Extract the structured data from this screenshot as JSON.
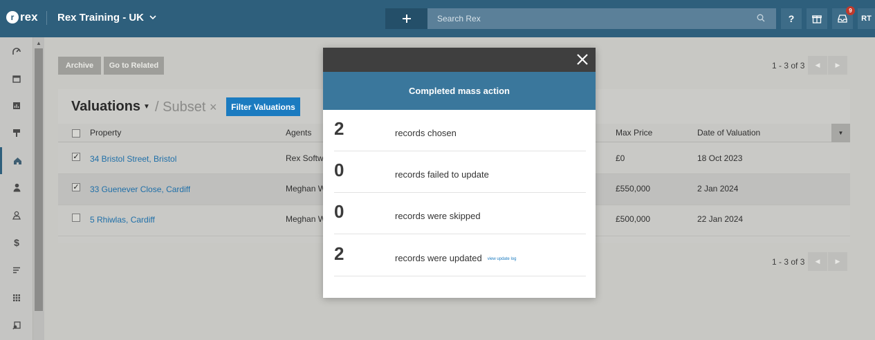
{
  "topbar": {
    "logo_text": "rex",
    "account_name": "Rex Training - UK",
    "search_placeholder": "Search Rex",
    "notifications_count": "9",
    "user_initials": "RT"
  },
  "sidebar": {
    "items": [
      "dashboard-icon",
      "calendar-icon",
      "reports-icon",
      "signboard-icon",
      "properties-icon",
      "contacts-icon",
      "leads-icon",
      "finance-icon",
      "lists-icon",
      "apps-icon",
      "search-listings-icon"
    ]
  },
  "toolbar": {
    "archive_label": "Archive",
    "related_label": "Go to Related",
    "pager_top": "1 - 3 of 3",
    "pager_bottom": "1 - 3 of 3",
    "prev_glyph": "◀",
    "next_glyph": "▶"
  },
  "list": {
    "title": "Valuations",
    "subset_label": "/ Subset",
    "subset_clear": "×",
    "filter_label": "Filter Valuations",
    "columns": {
      "property": "Property",
      "agents": "Agents",
      "max_price": "Max Price",
      "date": "Date of Valuation"
    },
    "rows": [
      {
        "checked": "✓",
        "property": "34 Bristol Street, Bristol",
        "agents": "Rex Software",
        "max_price": "£0",
        "date": "18 Oct 2023"
      },
      {
        "checked": "✓",
        "property": "33 Guenever Close, Cardiff",
        "agents": "Meghan Walker",
        "max_price": "£550,000",
        "date": "2 Jan 2024"
      },
      {
        "checked": "",
        "property": "5 Rhiwlas, Cardiff",
        "agents": "Meghan Walker",
        "max_price": "£500,000",
        "date": "22 Jan 2024"
      }
    ]
  },
  "modal": {
    "title": "Completed mass action",
    "stats": [
      {
        "num": "2",
        "label": "records chosen"
      },
      {
        "num": "0",
        "label": "records failed to update"
      },
      {
        "num": "0",
        "label": "records were skipped"
      },
      {
        "num": "2",
        "label": "records were updated",
        "link": "view update log"
      }
    ]
  },
  "colors": {
    "topbar": "#2e5f7c",
    "accent": "#1b7bc0",
    "modal_header": "#3a779c"
  }
}
